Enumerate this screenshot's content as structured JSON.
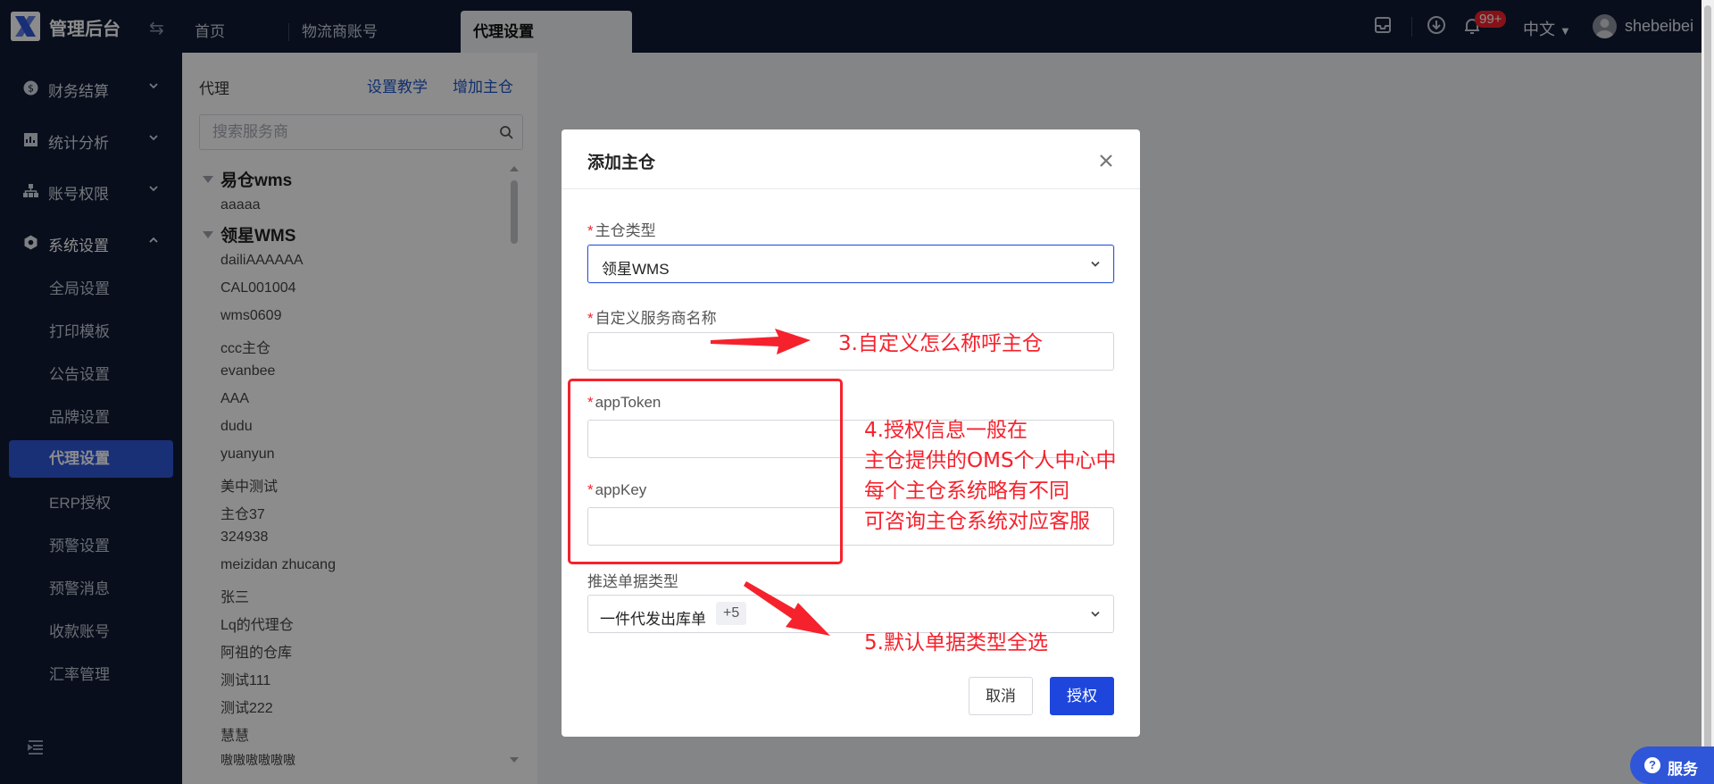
{
  "app": {
    "title": "管理后台"
  },
  "tabs": [
    {
      "label": "首页"
    },
    {
      "label": "物流商账号"
    },
    {
      "label": "代理设置"
    }
  ],
  "header": {
    "badge": "99+",
    "language": "中文",
    "username": "shebeibei"
  },
  "sidebar": {
    "groups": [
      {
        "label": "财务结算",
        "icon": "dollar-icon"
      },
      {
        "label": "统计分析",
        "icon": "report-icon"
      },
      {
        "label": "账号权限",
        "icon": "org-chart-icon"
      },
      {
        "label": "系统设置",
        "icon": "settings-icon"
      }
    ],
    "items": [
      {
        "label": "全局设置"
      },
      {
        "label": "打印模板"
      },
      {
        "label": "公告设置"
      },
      {
        "label": "品牌设置"
      },
      {
        "label": "代理设置",
        "active": true
      },
      {
        "label": "ERP授权"
      },
      {
        "label": "预警设置"
      },
      {
        "label": "预警消息"
      },
      {
        "label": "收款账号"
      },
      {
        "label": "汇率管理"
      }
    ]
  },
  "panel": {
    "title": "代理",
    "link_tutorial": "设置教学",
    "link_add": "增加主仓",
    "search_placeholder": "搜索服务商",
    "tree": {
      "cat1": {
        "label": "易仓wms",
        "items": [
          "aaaaa"
        ]
      },
      "cat2": {
        "label": "领星WMS",
        "items": [
          "dailiAAAAAA",
          "CAL001004",
          "wms0609",
          "ccc主仓",
          "evanbee",
          "AAA",
          "dudu",
          "yuanyun",
          "美中测试",
          "主仓37",
          "324938",
          "meizidan zhucang",
          "张三",
          "Lq的代理仓",
          "阿祖的仓库",
          "测试111",
          "测试222",
          "慧慧",
          "嗷嗷嗷嗷嗷嗷"
        ]
      }
    }
  },
  "modal": {
    "title": "添加主仓",
    "fields": {
      "type_label": "主仓类型",
      "type_value": "领星WMS",
      "name_label": "自定义服务商名称",
      "name_value": "",
      "token_label": "appToken",
      "token_value": "",
      "key_label": "appKey",
      "key_value": "",
      "doc_label": "推送单据类型",
      "doc_value": "一件代发出库单",
      "doc_more": "+5"
    },
    "cancel": "取消",
    "confirm": "授权"
  },
  "annotations": {
    "a3": "3.自定义怎么称呼主仓",
    "a4_lines": [
      "4.授权信息一般在",
      "主仓提供的OMS个人中心中",
      "每个主仓系统略有不同",
      "可咨询主仓系统对应客服"
    ],
    "a5": "5.默认单据类型全选"
  },
  "service": {
    "label": "服务"
  },
  "colors": {
    "sidebar_bg": "#0f1a34",
    "accent": "#2f56d8",
    "annotation": "#f5222d"
  }
}
